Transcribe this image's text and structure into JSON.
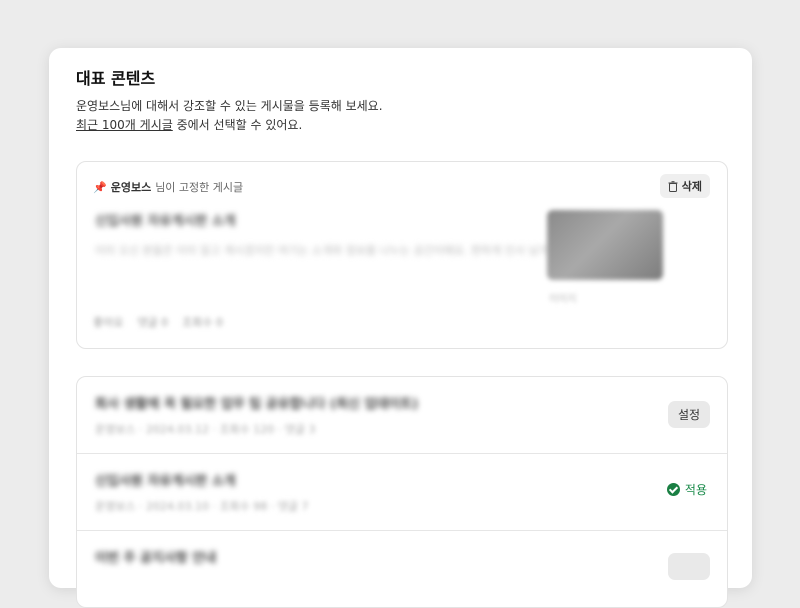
{
  "header": {
    "title": "대표 콘텐츠",
    "desc_line1": "운영보스님에 대해서 강조할 수 있는 게시물을 등록해 보세요.",
    "desc_link": "최근 100개 게시글",
    "desc_line2_rest": " 중에서 선택할 수 있어요."
  },
  "pinned": {
    "pin_icon": "pin-icon",
    "author": "운영보스",
    "label_suffix": "님이 고정한 게시글",
    "delete_label": "삭제",
    "post_title": "신입사원 자유게시판 소개",
    "post_body": "이미 오신 분들은 이미 알고 계시겠지만 여기는 소개와 정보를 나누는 공간이에요. 편하게 인사 남겨주세요 :)",
    "thumb_caption": "이미지",
    "meta": [
      "좋아요",
      "댓글 0",
      "조회수 0"
    ]
  },
  "list": [
    {
      "title": "회사 생활에 꼭 필요한 업무 팁 공유합니다 (최신 업데이트)",
      "meta": "운영보스 · 2024.03.12 · 조회수 120 · 댓글 3",
      "action": "설정"
    },
    {
      "title": "신입사원 자유게시판 소개",
      "meta": "운영보스 · 2024.03.10 · 조회수 98 · 댓글 7",
      "action": "적용"
    },
    {
      "title": "이번 주 공지사항 안내",
      "meta": "",
      "action": ""
    }
  ],
  "colors": {
    "accent_green": "#1a7f43",
    "pin": "#f5a623"
  }
}
